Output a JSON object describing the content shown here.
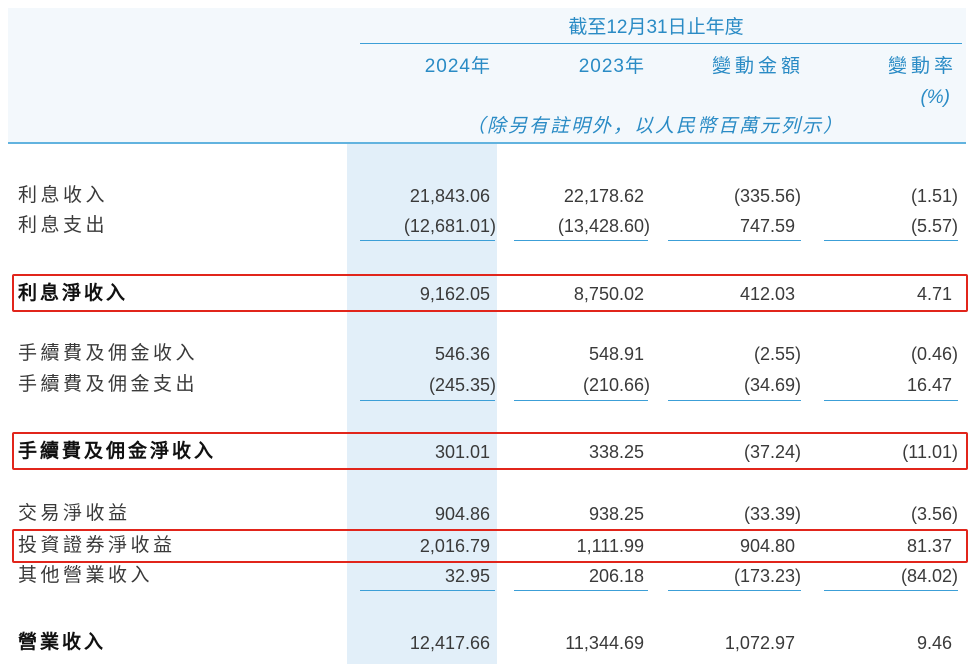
{
  "header": {
    "period": "截至12月31日止年度",
    "columns": [
      "2024年",
      "2023年",
      "變動金額",
      "變動率"
    ],
    "percent_unit": "(%)",
    "unit_note": "（除另有註明外，以人民幣百萬元列示）"
  },
  "rows": [
    {
      "label": "利息收入",
      "values": [
        "21,843.06",
        "22,178.62",
        "(335.56)",
        "(1.51)"
      ]
    },
    {
      "label": "利息支出",
      "values": [
        "(12,681.01)",
        "(13,428.60)",
        "747.59",
        "(5.57)"
      ]
    },
    {
      "label": "利息淨收入",
      "values": [
        "9,162.05",
        "8,750.02",
        "412.03",
        "4.71"
      ]
    },
    {
      "label": "手續費及佣金收入",
      "values": [
        "546.36",
        "548.91",
        "(2.55)",
        "(0.46)"
      ]
    },
    {
      "label": "手續費及佣金支出",
      "values": [
        "(245.35)",
        "(210.66)",
        "(34.69)",
        "16.47"
      ]
    },
    {
      "label": "手續費及佣金淨收入",
      "values": [
        "301.01",
        "338.25",
        "(37.24)",
        "(11.01)"
      ]
    },
    {
      "label": "交易淨收益",
      "values": [
        "904.86",
        "938.25",
        "(33.39)",
        "(3.56)"
      ]
    },
    {
      "label": "投資證券淨收益",
      "values": [
        "2,016.79",
        "1,111.99",
        "904.80",
        "81.37"
      ]
    },
    {
      "label": "其他營業收入",
      "values": [
        "32.95",
        "206.18",
        "(173.23)",
        "(84.02)"
      ]
    },
    {
      "label": "營業收入",
      "values": [
        "12,417.66",
        "11,344.69",
        "1,072.97",
        "9.46"
      ]
    }
  ],
  "colors": {
    "accent": "#2a8bc5",
    "rule": "#3c9fd7",
    "highlight": "#e1251b",
    "column_shade": "#e2eff9"
  }
}
